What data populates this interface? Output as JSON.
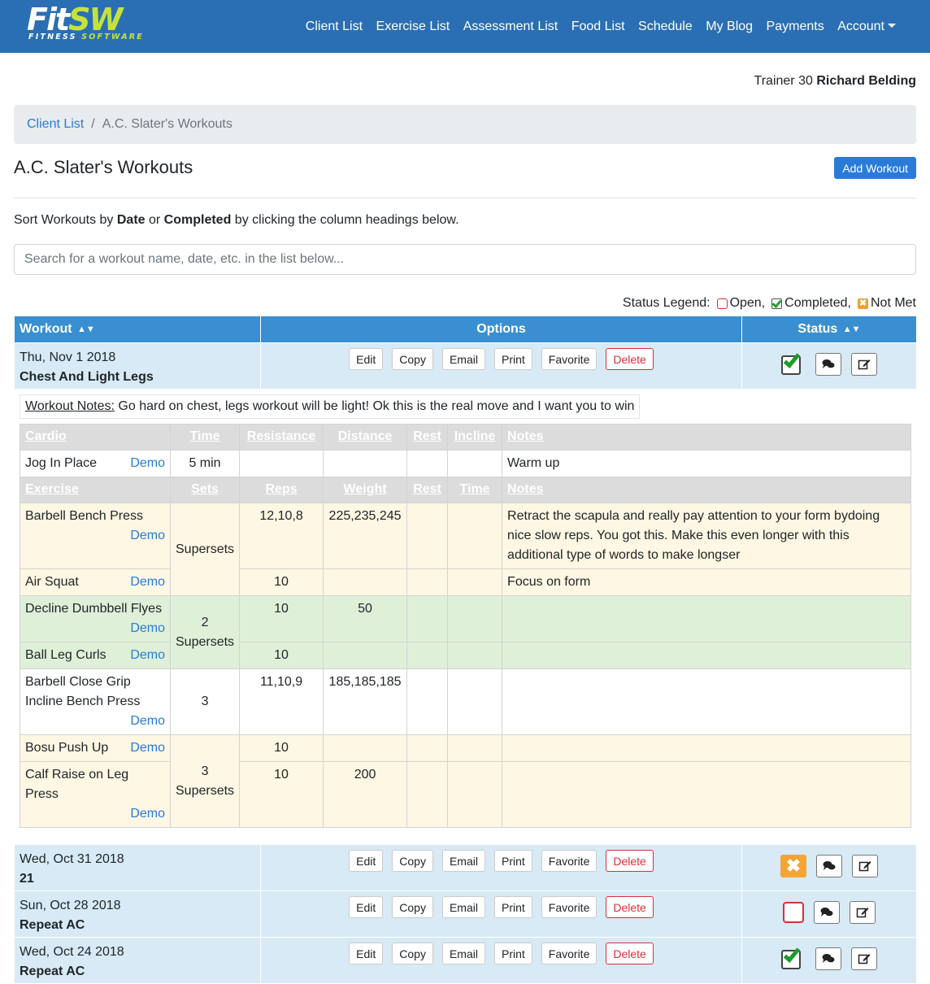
{
  "brand": {
    "logo_fit": "Fit",
    "logo_sw": "SW",
    "tagline_a": "FITNESS ",
    "tagline_b": "SOFTWARE"
  },
  "nav": {
    "items": [
      "Client List",
      "Exercise List",
      "Assessment List",
      "Food List",
      "Schedule",
      "My Blog",
      "Payments"
    ],
    "account": "Account"
  },
  "trainer": {
    "prefix": "Trainer 30",
    "name": "Richard Belding"
  },
  "breadcrumb": {
    "link": "Client List",
    "current": "A.C. Slater's Workouts"
  },
  "page": {
    "title": "A.C. Slater's Workouts",
    "add_button": "Add Workout",
    "sort_a": "Sort Workouts by ",
    "sort_date": "Date",
    "sort_or": " or ",
    "sort_completed": "Completed",
    "sort_b": " by clicking the column headings below.",
    "search_placeholder": "Search for a workout name, date, etc. in the list below..."
  },
  "legend": {
    "label": "Status Legend:",
    "open": "Open,",
    "completed": "Completed,",
    "not_met": "Not Met",
    "not_met_glyph": "✖"
  },
  "table": {
    "col_workout": "Workout",
    "col_options": "Options",
    "col_status": "Status"
  },
  "options": {
    "edit": "Edit",
    "copy": "Copy",
    "email": "Email",
    "print": "Print",
    "favorite": "Favorite",
    "delete": "Delete"
  },
  "workouts": [
    {
      "date": "Thu, Nov 1 2018",
      "name": "Chest And Light Legs",
      "status": "completed"
    },
    {
      "date": "Wed, Oct 31 2018",
      "name": "21",
      "status": "not_met"
    },
    {
      "date": "Sun, Oct 28 2018",
      "name": "Repeat AC",
      "status": "open"
    },
    {
      "date": "Wed, Oct 24 2018",
      "name": "Repeat AC",
      "status": "completed"
    }
  ],
  "detail": {
    "notes_label": "Workout Notes:",
    "notes_text": " Go hard on chest, legs workout will be light! Ok this is the real move and I want you to win",
    "cardio_headers": [
      "Cardio",
      "Time",
      "Resistance",
      "Distance",
      "Rest",
      "Incline",
      "Notes"
    ],
    "cardio_row": {
      "name": "Jog In Place",
      "demo": "Demo",
      "time": "5 min",
      "notes": "Warm up"
    },
    "exercise_headers": [
      "Exercise",
      "Sets",
      "Reps",
      "Weight",
      "Rest",
      "Time",
      "Notes"
    ],
    "exercises": [
      {
        "name": "Barbell Bench Press",
        "demo": "Demo",
        "sets": "Supersets",
        "reps": "12,10,8",
        "weight": "225,235,245",
        "notes": "Retract the scapula and really pay attention to your form bydoing nice slow reps. You got this. Make this even longer with this additional type of words to make longser"
      },
      {
        "name": "Air Squat",
        "demo": "Demo",
        "reps": "10",
        "notes": "Focus on form"
      },
      {
        "name": "Decline Dumbbell Flyes",
        "demo": "Demo",
        "sets_num": "2",
        "sets": "Supersets",
        "reps": "10",
        "weight": "50"
      },
      {
        "name": "Ball Leg Curls",
        "demo": "Demo",
        "reps": "10"
      },
      {
        "name_a": "Barbell Close Grip",
        "name_b": "Incline Bench Press",
        "demo": "Demo",
        "sets": "3",
        "reps": "11,10,9",
        "weight": "185,185,185"
      },
      {
        "name": "Bosu Push Up",
        "demo": "Demo",
        "sets_num": "3",
        "sets": "Supersets",
        "reps": "10"
      },
      {
        "name": "Calf Raise on Leg Press",
        "demo": "Demo",
        "reps": "10",
        "weight": "200"
      }
    ]
  },
  "icons": {
    "comment": "comment-icon",
    "edit": "edit-icon",
    "sort": "sort-icon"
  }
}
